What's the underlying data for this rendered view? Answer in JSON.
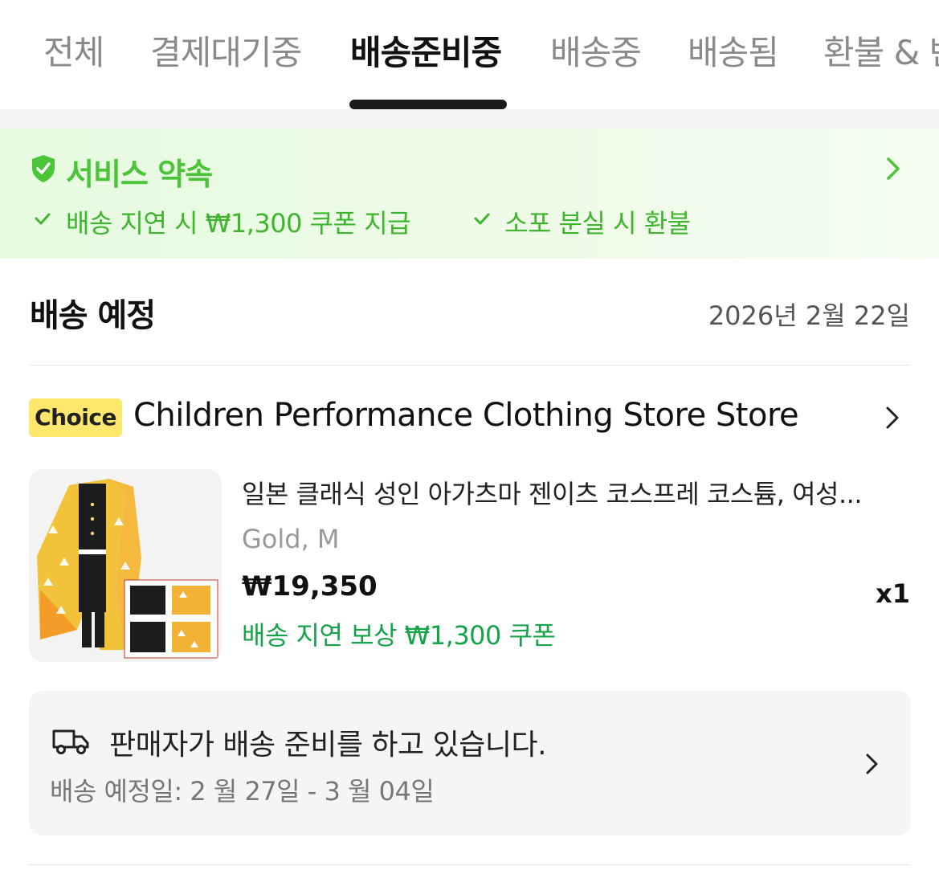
{
  "tabs": [
    {
      "label": "전체",
      "active": false
    },
    {
      "label": "결제대기중",
      "active": false
    },
    {
      "label": "배송준비중",
      "active": true
    },
    {
      "label": "배송중",
      "active": false
    },
    {
      "label": "배송됨",
      "active": false
    },
    {
      "label": "환불 & 반",
      "active": false
    }
  ],
  "service_promise": {
    "title": "서비스 약속",
    "items": [
      "배송 지연 시 ₩1,300 쿠폰 지급",
      "소포 분실 시 환불"
    ],
    "color": "#4cc43a",
    "icon": "shield-check-icon"
  },
  "delivery": {
    "title": "배송 예정",
    "date": "2026년 2월 22일"
  },
  "store": {
    "badge": "Choice",
    "name": "Children Performance Clothing Store Store"
  },
  "product": {
    "title": "일본 클래식 성인 아가츠마 젠이츠 코스프레 코스튬, 여성...",
    "variant": "Gold, M",
    "price": "₩19,350",
    "quantity": "x1",
    "coupon_note": "배송 지연 보상 ₩1,300 쿠폰"
  },
  "shipping_status": {
    "status": "판매자가 배송 준비를 하고 있습니다.",
    "eta": "배송 예정일: 2 월 27일 - 3 월 04일",
    "icon": "truck-icon"
  }
}
